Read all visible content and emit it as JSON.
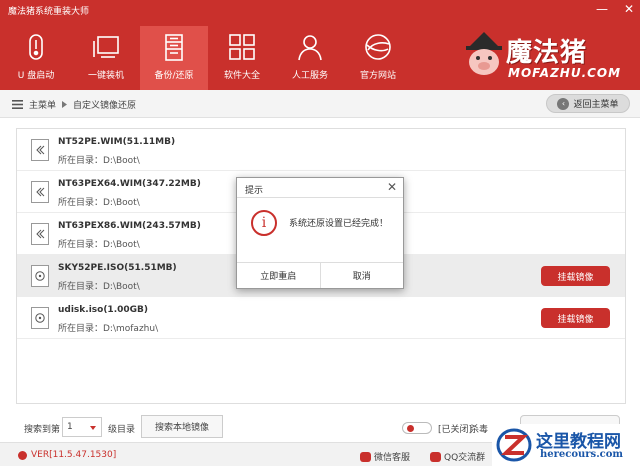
{
  "app": {
    "title": "魔法猪系统重装大师",
    "brand_color": "#c9302c"
  },
  "window_controls": {
    "minimize_symbol": "—",
    "close_symbol": "✕"
  },
  "nav": {
    "items": [
      {
        "label": "U 盘启动",
        "icon": "usb-icon"
      },
      {
        "label": "一键装机",
        "icon": "monitor-icon"
      },
      {
        "label": "备份/还原",
        "icon": "backup-icon",
        "active": true
      },
      {
        "label": "软件大全",
        "icon": "apps-grid-icon"
      },
      {
        "label": "人工服务",
        "icon": "person-icon"
      },
      {
        "label": "官方网站",
        "icon": "globe-icon"
      }
    ]
  },
  "logo": {
    "main": "魔法猪",
    "sub": "MOFAZHU.COM"
  },
  "breadcrumb": {
    "home": "主菜单",
    "current": "自定义镜像还原"
  },
  "back_button": {
    "label": "返回主菜单"
  },
  "images": [
    {
      "name": "NT52PE.WIM(51.11MB)",
      "path": "所在目录：D:\\Boot\\",
      "type": "wim"
    },
    {
      "name": "NT63PEX64.WIM(347.22MB)",
      "path": "所在目录：D:\\Boot\\",
      "type": "wim"
    },
    {
      "name": "NT63PEX86.WIM(243.57MB)",
      "path": "所在目录：D:\\Boot\\",
      "type": "wim"
    },
    {
      "name": "SKY52PE.ISO(51.51MB)",
      "path": "所在目录：D:\\Boot\\",
      "type": "iso",
      "selected": true,
      "action": "挂载镜像"
    },
    {
      "name": "udisk.iso(1.00GB)",
      "path": "所在目录：D:\\mofazhu\\",
      "type": "iso",
      "action": "挂载镜像"
    }
  ],
  "bottom": {
    "search_label": "搜索到第",
    "disk_level": "1",
    "level_suffix": "级目录",
    "local_search_button": "搜索本地镜像",
    "toggle_state": "[已关闭]",
    "antivirus_label": "杀毒"
  },
  "status": {
    "version": "VER[11.5.47.1530]",
    "wechat": "微信客服",
    "qq": "QQ交流群"
  },
  "watermark": {
    "title": "这里教程网",
    "url": "herecours.com"
  },
  "dialog": {
    "title": "提示",
    "close_symbol": "✕",
    "icon_symbol": "i",
    "message": "系统还原设置已经完成！",
    "confirm_label": "立即重启",
    "cancel_label": "取消"
  }
}
